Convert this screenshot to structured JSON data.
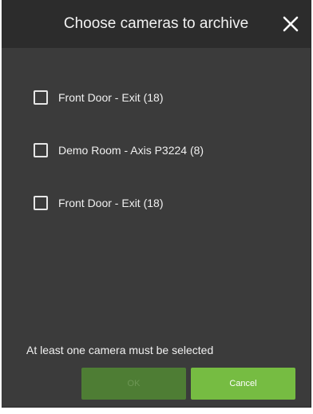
{
  "dialog": {
    "title": "Choose cameras to archive",
    "close_icon": "close-icon"
  },
  "cameras": [
    {
      "label": "Front Door - Exit (18)",
      "checked": false
    },
    {
      "label": "Demo Room - Axis P3224 (8)",
      "checked": false
    },
    {
      "label": "Front Door - Exit (18)",
      "checked": false
    }
  ],
  "validation_message": "At least one camera must be selected",
  "buttons": {
    "ok_label": "OK",
    "ok_enabled": false,
    "cancel_label": "Cancel"
  },
  "colors": {
    "dialog_bg": "#3b3b3b",
    "titlebar_bg": "#2c2c2c",
    "ok_disabled": "#4e7d34",
    "cancel": "#76bc42"
  }
}
